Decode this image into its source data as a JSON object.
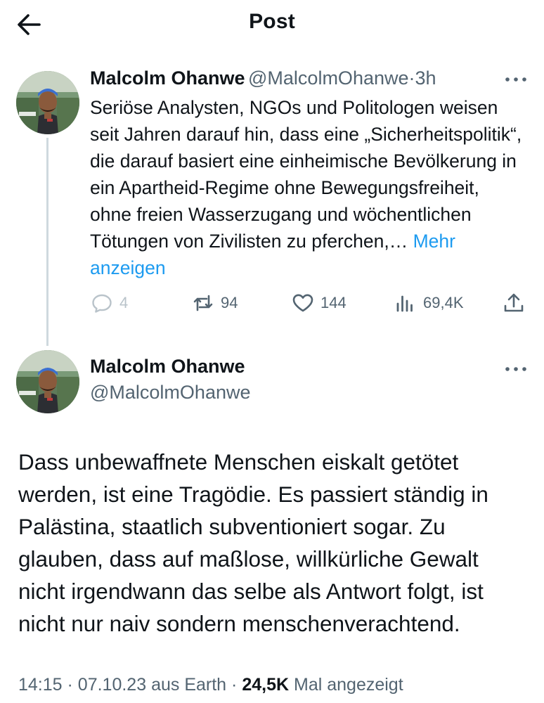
{
  "header": {
    "title": "Post",
    "back_icon": "arrow-left-icon"
  },
  "reply_to": {
    "name": "Malcolm Ohanwe",
    "handle": "@MalcolmOhanwe",
    "separator": "·",
    "time": "3h",
    "text": "Seriöse Analysten, NGOs und Politologen weisen seit Jahren darauf hin, dass eine „Sicherheitspolitik“, die darauf basiert eine einheimische Bevölkerung in ein Apartheid-Regime ohne Bewegungsfreiheit, ohne freien Wasserzugang und wöchentlichen Tötungen von Zivilisten zu pferchen,…",
    "show_more": "Mehr anzeigen",
    "actions": {
      "replies": "4",
      "reposts": "94",
      "likes": "144",
      "views": "69,4K"
    }
  },
  "post": {
    "name": "Malcolm Ohanwe",
    "handle": "@MalcolmOhanwe",
    "text": "Dass unbewaffnete Menschen eiskalt getötet werden, ist eine Tragödie. Es passiert ständig in Palästina, staatlich subventioniert sogar. Zu glauben, dass auf maßlose, willkürliche Gewalt nicht irgendwann das selbe als Antwort folgt, ist nicht nur naiv sondern menschenverachtend.",
    "time": "14:15",
    "date": "07.10.23",
    "location": "aus Earth",
    "separator": "·",
    "views_count": "24,5K",
    "views_label": "Mal angezeigt"
  },
  "colors": {
    "accent": "#1d9bf0",
    "text": "#0f1419",
    "secondary": "#536471",
    "thread_line": "#cfd9de"
  }
}
